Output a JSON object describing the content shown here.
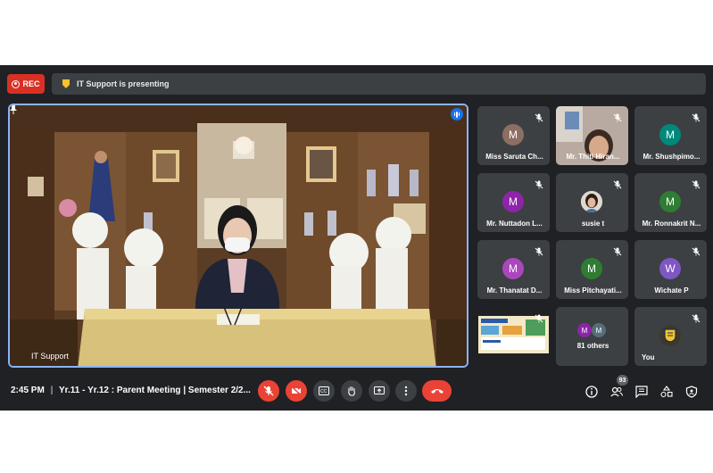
{
  "recording": {
    "label": "REC"
  },
  "banner": {
    "text": "IT Support is presenting"
  },
  "stage": {
    "participant": "IT Support"
  },
  "participants": [
    {
      "name": "Miss Saruta Ch...",
      "initial": "M",
      "color": "#8d6e63",
      "type": "avatar"
    },
    {
      "name": "Mr. Thiti Hiran...",
      "initial": "",
      "color": "",
      "type": "video"
    },
    {
      "name": "Mr. Shushpimo...",
      "initial": "M",
      "color": "#00897b",
      "type": "avatar"
    },
    {
      "name": "Mr. Nuttadon L...",
      "initial": "M",
      "color": "#8e24aa",
      "type": "avatar"
    },
    {
      "name": "susie t",
      "initial": "",
      "color": "",
      "type": "photo"
    },
    {
      "name": "Mr. Ronnakrit N...",
      "initial": "M",
      "color": "#2e7d32",
      "type": "avatar"
    },
    {
      "name": "Mr. Thanatat D...",
      "initial": "M",
      "color": "#ab47bc",
      "type": "avatar"
    },
    {
      "name": "Miss Pitchayati...",
      "initial": "M",
      "color": "#2e7d32",
      "type": "avatar"
    },
    {
      "name": "Wichate P",
      "initial": "W",
      "color": "#7e57c2",
      "type": "avatar"
    },
    {
      "name": "",
      "initial": "",
      "color": "",
      "type": "screen"
    },
    {
      "name": "81 others",
      "initial": "M",
      "color": "#8e24aa",
      "type": "others"
    },
    {
      "name": "You",
      "initial": "",
      "color": "",
      "type": "you"
    }
  ],
  "others": {
    "initials": [
      "M",
      "M"
    ],
    "colors": [
      "#8e24aa",
      "#546e7a"
    ]
  },
  "bottom_bar": {
    "time": "2:45 PM",
    "separator": "|",
    "meeting_title": "Yr.11 - Yr.12 : Parent Meeting | Semester 2/2...",
    "people_count": "93"
  },
  "colors": {
    "accent": "#8ab4f8",
    "danger": "#ea4335",
    "background": "#202124",
    "tile": "#3c4043"
  }
}
